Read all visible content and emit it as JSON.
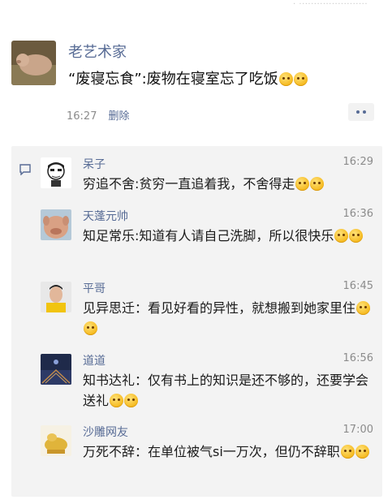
{
  "watermark": "· ·······················",
  "post": {
    "author": "老艺术家",
    "text": "“废寝忘食”:废物在寝室忘了吃饭",
    "emoji": [
      "emoji-face",
      "emoji-face"
    ],
    "time": "16:27",
    "delete_label": "删除"
  },
  "comments": [
    {
      "name": "呆子",
      "time": "16:29",
      "text": "穷追不舍:贫穷一直追着我，不舍得走",
      "emoji_count": 2
    },
    {
      "name": "天蓬元帅",
      "time": "16:36",
      "text": "知足常乐:知道有人请自己洗脚，所以很快乐",
      "emoji_count": 2
    },
    {
      "name": "平哥",
      "time": "16:45",
      "text": "见异思迁：看见好看的异性，就想搬到她家里住",
      "emoji_count": 2
    },
    {
      "name": "道道",
      "time": "16:56",
      "text": "知书达礼：仅有书上的知识是还不够的，还要学会送礼",
      "emoji_count": 2
    },
    {
      "name": "沙雕网友",
      "time": "17:00",
      "text": "万死不辞：在单位被气si一万次，但仍不辞职",
      "emoji_count": 2
    }
  ],
  "colors": {
    "link": "#576b95",
    "meta": "#8c8c8c",
    "comment_bg": "#f3f3f3"
  }
}
